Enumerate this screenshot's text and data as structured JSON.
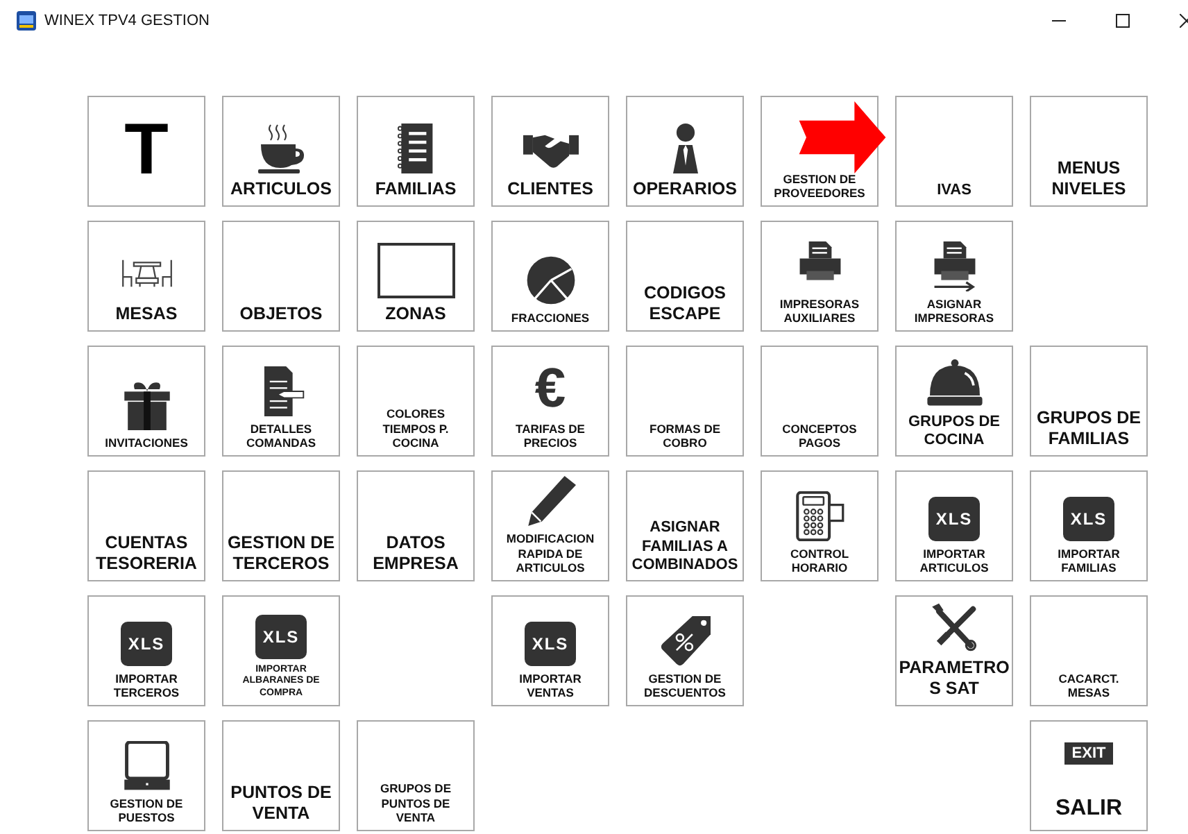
{
  "window": {
    "title": "WINEX TPV4 GESTION"
  },
  "tiles": [
    {
      "icon_text": "T"
    },
    {
      "lines": [
        "ARTICULOS"
      ]
    },
    {
      "lines": [
        "FAMILIAS"
      ]
    },
    {
      "lines": [
        "CLIENTES"
      ]
    },
    {
      "lines": [
        "OPERARIOS"
      ]
    },
    {
      "lines": [
        "GESTION DE",
        "PROVEEDORES"
      ]
    },
    {
      "lines": [
        "IVAS"
      ]
    },
    {
      "lines": [
        "MENUS",
        "NIVELES"
      ]
    },
    {
      "lines": [
        "MESAS"
      ]
    },
    {
      "lines": [
        "OBJETOS"
      ]
    },
    {
      "lines": [
        "ZONAS"
      ]
    },
    {
      "lines": [
        "FRACCIONES"
      ]
    },
    {
      "lines": [
        "CODIGOS",
        "ESCAPE"
      ]
    },
    {
      "lines": [
        "IMPRESORAS",
        "AUXILIARES"
      ]
    },
    {
      "lines": [
        "ASIGNAR",
        "IMPRESORAS"
      ]
    },
    {
      "lines": [
        "INVITACIONES"
      ]
    },
    {
      "lines": [
        "DETALLES",
        "COMANDAS"
      ]
    },
    {
      "lines": [
        "COLORES",
        "TIEMPOS P.",
        "COCINA"
      ]
    },
    {
      "icon_text": "€",
      "lines": [
        "TARIFAS DE",
        "PRECIOS"
      ]
    },
    {
      "lines": [
        "FORMAS DE",
        "COBRO"
      ]
    },
    {
      "lines": [
        "CONCEPTOS",
        "PAGOS"
      ]
    },
    {
      "lines": [
        "GRUPOS DE",
        "COCINA"
      ]
    },
    {
      "lines": [
        "GRUPOS DE",
        "FAMILIAS"
      ]
    },
    {
      "lines": [
        "CUENTAS",
        "TESORERIA"
      ]
    },
    {
      "lines": [
        "GESTION DE",
        "TERCEROS"
      ]
    },
    {
      "lines": [
        "DATOS",
        "EMPRESA"
      ]
    },
    {
      "lines": [
        "MODIFICACION",
        "RAPIDA DE",
        "ARTICULOS"
      ]
    },
    {
      "lines": [
        "ASIGNAR",
        "FAMILIAS A",
        "COMBINADOS"
      ]
    },
    {
      "lines": [
        "CONTROL",
        "HORARIO"
      ]
    },
    {
      "icon_text": "XLS",
      "lines": [
        "IMPORTAR",
        "ARTICULOS"
      ]
    },
    {
      "icon_text": "XLS",
      "lines": [
        "IMPORTAR",
        "FAMILIAS"
      ]
    },
    {
      "icon_text": "XLS",
      "lines": [
        "IMPORTAR",
        "TERCEROS"
      ]
    },
    {
      "icon_text": "XLS",
      "lines": [
        "IMPORTAR",
        "ALBARANES DE",
        "COMPRA"
      ]
    },
    {
      "icon_text": "XLS",
      "lines": [
        "IMPORTAR",
        "VENTAS"
      ]
    },
    {
      "lines": [
        "GESTION DE",
        "DESCUENTOS"
      ]
    },
    {
      "lines": [
        "PARAMETRO",
        "S SAT"
      ]
    },
    {
      "lines": [
        "CACARCT.",
        "MESAS"
      ]
    },
    {
      "lines": [
        "GESTION DE",
        "PUESTOS"
      ]
    },
    {
      "lines": [
        "PUNTOS DE",
        "VENTA"
      ]
    },
    {
      "lines": [
        "GRUPOS DE",
        "PUNTOS DE",
        "VENTA"
      ]
    },
    {
      "icon_text": "EXIT",
      "lines": [
        "SALIR"
      ]
    }
  ]
}
